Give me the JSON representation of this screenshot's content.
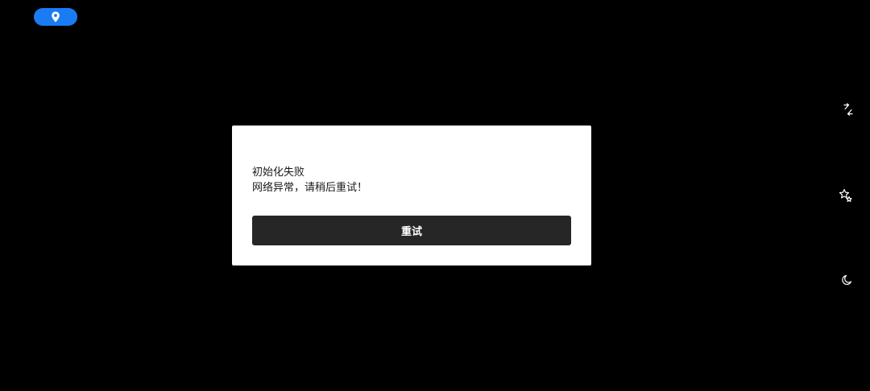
{
  "top_bar": {
    "location_button": {
      "icon": "location-pin-icon",
      "background": "#1a7cf5"
    }
  },
  "side_toolbar": {
    "items": [
      {
        "icon": "rotate-icon"
      },
      {
        "icon": "effects-sparkle-icon"
      },
      {
        "icon": "night-mode-moon-icon"
      }
    ]
  },
  "dialog": {
    "title": "初始化失败",
    "message": "网络异常，请稍后重试！",
    "retry_label": "重试",
    "button_color": "#262626"
  }
}
